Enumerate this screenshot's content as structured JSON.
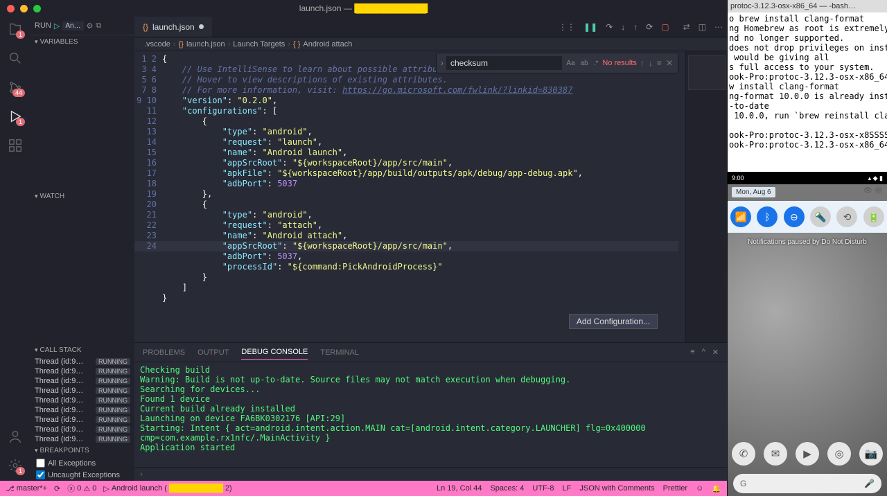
{
  "window_title_prefix": "launch.json — ",
  "activity": {
    "explorer_badge": "1",
    "scm_badge": "44",
    "run_badge": "1",
    "bottom_badge": "1"
  },
  "run_panel": {
    "label": "RUN",
    "config": "An…",
    "sections": {
      "variables": "VARIABLES",
      "watch": "WATCH",
      "callstack": "CALL STACK",
      "breakpoints": "BREAKPOINTS"
    },
    "threads": [
      {
        "name": "Thread (id:9…",
        "state": "RUNNING"
      },
      {
        "name": "Thread (id:9…",
        "state": "RUNNING"
      },
      {
        "name": "Thread (id:9…",
        "state": "RUNNING"
      },
      {
        "name": "Thread (id:9…",
        "state": "RUNNING"
      },
      {
        "name": "Thread (id:9…",
        "state": "RUNNING"
      },
      {
        "name": "Thread (id:9…",
        "state": "RUNNING"
      },
      {
        "name": "Thread (id:9…",
        "state": "RUNNING"
      },
      {
        "name": "Thread (id:9…",
        "state": "RUNNING"
      },
      {
        "name": "Thread (id:9…",
        "state": "RUNNING"
      }
    ],
    "bp_all": "All Exceptions",
    "bp_uncaught": "Uncaught Exceptions"
  },
  "tab": {
    "name": "launch.json"
  },
  "breadcrumb": {
    "a": ".vscode",
    "b": "launch.json",
    "c": "Launch Targets",
    "d": "Android attach"
  },
  "find": {
    "value": "checksum",
    "no_results": "No results"
  },
  "code": {
    "lines": [
      "{",
      "    // Use IntelliSense to learn about possible attributes.",
      "    // Hover to view descriptions of existing attributes.",
      "    // For more information, visit: https://go.microsoft.com/fwlink/?linkid=830387",
      "    \"version\": \"0.2.0\",",
      "    \"configurations\": [",
      "        {",
      "            \"type\": \"android\",",
      "            \"request\": \"launch\",",
      "            \"name\": \"Android launch\",",
      "            \"appSrcRoot\": \"${workspaceRoot}/app/src/main\",",
      "            \"apkFile\": \"${workspaceRoot}/app/build/outputs/apk/debug/app-debug.apk\",",
      "            \"adbPort\": 5037",
      "        },",
      "        {",
      "            \"type\": \"android\",",
      "            \"request\": \"attach\",",
      "            \"name\": \"Android attach\",",
      "            \"appSrcRoot\": \"${workspaceRoot}/app/src/main\",",
      "            \"adbPort\": 5037,",
      "            \"processId\": \"${command:PickAndroidProcess}\"",
      "        }",
      "    ]",
      "}"
    ],
    "add_config": "Add Configuration..."
  },
  "panel": {
    "tabs": {
      "problems": "PROBLEMS",
      "output": "OUTPUT",
      "debug": "DEBUG CONSOLE",
      "terminal": "TERMINAL"
    },
    "lines": [
      "Checking build",
      "Warning: Build is not up-to-date. Source files may not match execution when debugging.",
      "Searching for devices...",
      "Found 1 device",
      "Current build already installed",
      "Launching on device FA6BK0302176 [API:29]",
      "Starting: Intent { act=android.intent.action.MAIN cat=[android.intent.category.LAUNCHER] flg=0x400000 cmp=com.example.rx1nfc/.MainActivity }",
      "Application started"
    ]
  },
  "status": {
    "branch": "master*+",
    "sync": "",
    "errors": "0",
    "warnings": "0",
    "launch_prefix": "Android launch (",
    "launch_suffix": "2)",
    "lncol": "Ln 19, Col 44",
    "spaces": "Spaces: 4",
    "enc": "UTF-8",
    "eol": "LF",
    "lang": "JSON with Comments",
    "prettier": "Prettier"
  },
  "right_terminal": {
    "title": "protoc-3.12.3-osx-x86_64 — -bash…",
    "lines": [
      "o brew install clang-format",
      "ng Homebrew as root is extremely",
      "nd no longer supported.",
      "does not drop privileges on inst",
      " would be giving all",
      "s full access to your system.",
      "ook-Pro:protoc-3.12.3-osx-x86_64",
      "w install clang-format",
      "ng-format 10.0.0 is already inst",
      "-to-date",
      " 10.0.0, run `brew reinstall cla",
      "",
      "ook-Pro:protoc-3.12.3-osx-x8SSSS",
      "ook-Pro:protoc-3.12.3-osx-x86_64"
    ]
  },
  "emulator": {
    "clock": "9:00",
    "date": "Mon, Aug 6",
    "dnd": "Notifications paused by Do Not Disturb",
    "search": "G"
  }
}
